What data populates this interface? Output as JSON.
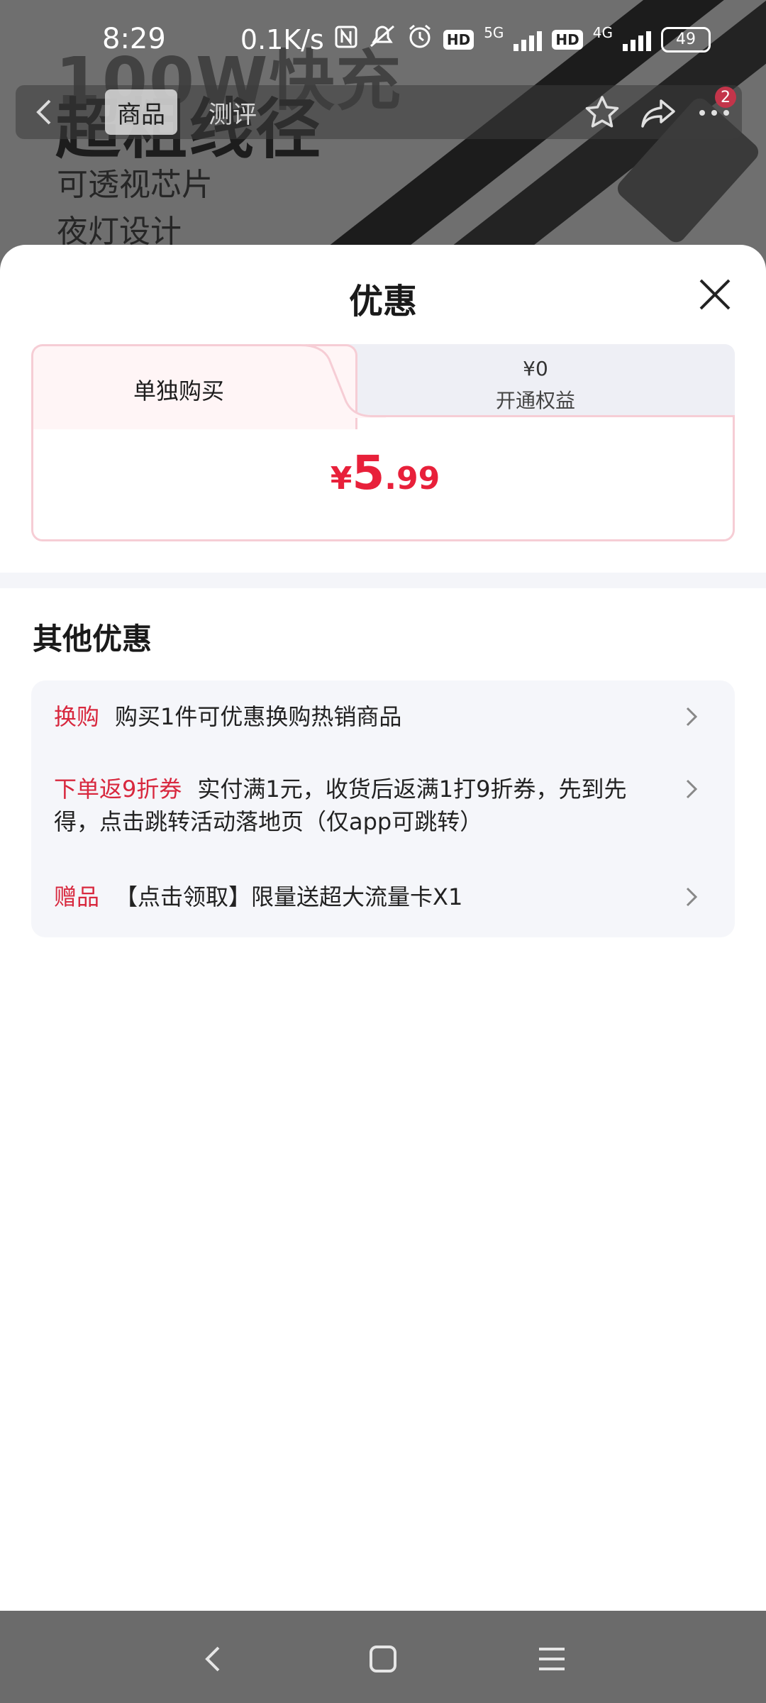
{
  "status_bar": {
    "time": "8:29",
    "net_speed": "0.1K/s",
    "sim1": "5G",
    "sim2": "4G",
    "hd_label": "HD",
    "battery": "49"
  },
  "product_bg": {
    "headline_ghost": "100W快充",
    "headline": "超粗线径",
    "features": [
      "可透视芯片",
      "夜灯设计"
    ]
  },
  "product_nav": {
    "tabs": [
      {
        "label": "商品",
        "active": true
      },
      {
        "label": "测评",
        "active": false
      }
    ],
    "more_badge": "2"
  },
  "sheet": {
    "title": "优惠",
    "price_tabs": {
      "left": {
        "label": "单独购买"
      },
      "right": {
        "price": "¥0",
        "label": "开通权益"
      }
    },
    "price": {
      "currency": "¥",
      "integer": "5",
      "decimal": ".99"
    },
    "other_title": "其他优惠",
    "promos": [
      {
        "tag": "换购",
        "text": "购买1件可优惠换购热销商品"
      },
      {
        "tag": "下单返9折券",
        "text": "实付满1元，收货后返满1打9折券，先到先得，点击跳转活动落地页（仅app可跳转）"
      },
      {
        "tag": "赠品",
        "text": "【点击领取】限量送超大流量卡X1"
      }
    ]
  },
  "colors": {
    "accent": "#e8203a",
    "tag": "#d8283e",
    "card_border": "#f6cdd5",
    "promo_bg": "#f5f6fa",
    "overlay": "#6f6f6f",
    "sys_nav": "#6b6b6b"
  }
}
